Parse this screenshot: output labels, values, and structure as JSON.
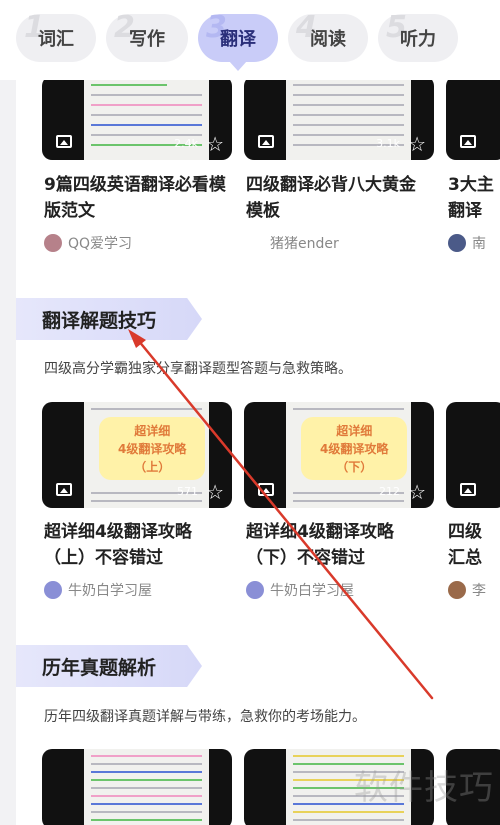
{
  "tabs": [
    {
      "num": "1",
      "label": "词汇",
      "active": false
    },
    {
      "num": "2",
      "label": "写作",
      "active": false
    },
    {
      "num": "3",
      "label": "翻译",
      "active": true
    },
    {
      "num": "4",
      "label": "阅读",
      "active": false
    },
    {
      "num": "5",
      "label": "听力",
      "active": false
    }
  ],
  "row1": {
    "cards": [
      {
        "count": "2.4k",
        "title_l1": "9篇四级英语翻译必看模",
        "title_l2": "版范文",
        "author": "QQ爱学习"
      },
      {
        "count": "3.1k",
        "title_l1": "四级翻译必背八大黄金",
        "title_l2": "模板",
        "author": "猪猪ender"
      },
      {
        "title_l1": "3大主",
        "title_l2": "翻译",
        "author": "南"
      }
    ]
  },
  "section1": {
    "title": "翻译解题技巧",
    "desc": "四级高分学霸独家分享翻译题型答题与急救策略。",
    "cards": [
      {
        "count": "571",
        "sticker_l1": "超详细",
        "sticker_l2": "4级翻译攻略",
        "sticker_l3": "（上）",
        "title_l1": "超详细4级翻译攻略",
        "title_l2": "（上）不容错过",
        "author": "牛奶白学习屋"
      },
      {
        "count": "212",
        "sticker_l1": "超详细",
        "sticker_l2": "4级翻译攻略",
        "sticker_l3": "（下）",
        "title_l1": "超详细4级翻译攻略",
        "title_l2": "（下）不容错过",
        "author": "牛奶白学习屋"
      },
      {
        "title_l1": "四级",
        "title_l2": "汇总",
        "author": "李"
      }
    ]
  },
  "section2": {
    "title": "历年真题解析",
    "desc": "历年四级翻译真题详解与带练，急救你的考场能力。"
  },
  "watermark": "软件技巧",
  "colors": {
    "accent": "#c9ccf8",
    "arrow": "#d93a2b"
  }
}
